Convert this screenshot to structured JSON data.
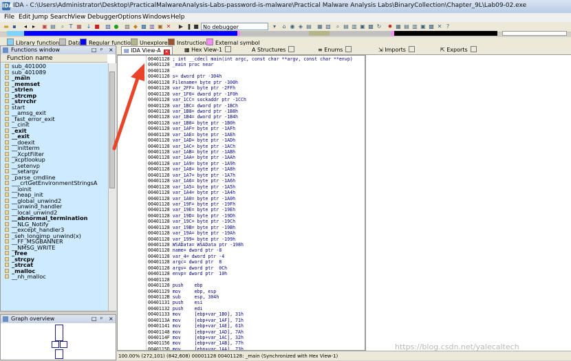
{
  "window": {
    "title": "IDA - C:\\Users\\Administrator\\Desktop\\PracticalMalwareAnalysis-Labs-password-is-malware\\Practical Malware Analysis Labs\\BinaryCollection\\Chapter_9L\\Lab09-02.exe",
    "app_icon_label": "IDA"
  },
  "menu": [
    "File",
    "Edit",
    "Jump",
    "Search",
    "View",
    "Debugger",
    "Options",
    "Windows",
    "Help"
  ],
  "toolbar": {
    "debugger_select": "No debugger"
  },
  "legend": [
    {
      "label": "Library function",
      "color": "#7fd4ff"
    },
    {
      "label": "Data",
      "color": "#c0c0c0"
    },
    {
      "label": "Regular function",
      "color": "#0000ff"
    },
    {
      "label": "Unexplored",
      "color": "#b5b58a"
    },
    {
      "label": "Instruction",
      "color": "#a0522d"
    },
    {
      "label": "External symbol",
      "color": "#ff88ff"
    }
  ],
  "functions_window": {
    "title": "Functions window",
    "column": "Function name",
    "items": [
      {
        "name": "sub_401000",
        "bold": false
      },
      {
        "name": "sub_401089",
        "bold": false
      },
      {
        "name": "_main",
        "bold": true
      },
      {
        "name": "_memset",
        "bold": true
      },
      {
        "name": "_strlen",
        "bold": true
      },
      {
        "name": "_strcmp",
        "bold": true
      },
      {
        "name": "_strrchr",
        "bold": true
      },
      {
        "name": "start",
        "bold": false
      },
      {
        "name": "__amsg_exit",
        "bold": false
      },
      {
        "name": "_fast_error_exit",
        "bold": false
      },
      {
        "name": "__cinit",
        "bold": false
      },
      {
        "name": "_exit",
        "bold": true
      },
      {
        "name": "__exit",
        "bold": true
      },
      {
        "name": "__doexit",
        "bold": false
      },
      {
        "name": "__initterm",
        "bold": false
      },
      {
        "name": "__XcptFilter",
        "bold": false
      },
      {
        "name": "_xcptlookup",
        "bold": false
      },
      {
        "name": "__setenvp",
        "bold": false
      },
      {
        "name": "__setargv",
        "bold": false
      },
      {
        "name": "_parse_cmdline",
        "bold": false
      },
      {
        "name": "___crtGetEnvironmentStringsA",
        "bold": false
      },
      {
        "name": "__ioinit",
        "bold": false
      },
      {
        "name": "__heap_init",
        "bold": false
      },
      {
        "name": "__global_unwind2",
        "bold": false
      },
      {
        "name": "__unwind_handler",
        "bold": false
      },
      {
        "name": "__local_unwind2",
        "bold": false
      },
      {
        "name": "__abnormal_termination",
        "bold": true
      },
      {
        "name": "__NLG_Notify",
        "bold": false
      },
      {
        "name": "__except_handler3",
        "bold": false
      },
      {
        "name": "_seh_longjmp_unwind(x)",
        "bold": false
      },
      {
        "name": "__FF_MSGBANNER",
        "bold": false
      },
      {
        "name": "__NMSG_WRITE",
        "bold": false
      },
      {
        "name": "_free",
        "bold": true
      },
      {
        "name": "_strcpy",
        "bold": true
      },
      {
        "name": "_strcat",
        "bold": true
      },
      {
        "name": "_malloc",
        "bold": true
      },
      {
        "name": "__nh_malloc",
        "bold": false
      }
    ]
  },
  "graph_overview": {
    "title": "Graph overview"
  },
  "tabs": [
    {
      "label": "IDA View-A",
      "active": true,
      "close": true
    },
    {
      "label": "Hex View-1",
      "active": false,
      "close": false
    },
    {
      "label": "Structures",
      "active": false,
      "close": false
    },
    {
      "label": "Enums",
      "active": false,
      "close": false
    },
    {
      "label": "Imports",
      "active": false,
      "close": false
    },
    {
      "label": "Exports",
      "active": false,
      "close": false
    }
  ],
  "disasm": [
    {
      "addr": "00401128",
      "text": "; int __cdecl main(int argc, const char **argv, const char **envp)"
    },
    {
      "addr": "00401128",
      "text": "_main proc near"
    },
    {
      "addr": "00401128",
      "text": ""
    },
    {
      "addr": "00401128",
      "text": "s= dword ptr -304h"
    },
    {
      "addr": "00401128",
      "text": "Filename= byte ptr -300h"
    },
    {
      "addr": "00401128",
      "text": "var_2FF= byte ptr -2FFh"
    },
    {
      "addr": "00401128",
      "text": "var_1F0= dword ptr -1F0h"
    },
    {
      "addr": "00401128",
      "text": "var_1CC= sockaddr ptr -1CCh"
    },
    {
      "addr": "00401128",
      "text": "var_1BC= dword ptr -1BCh"
    },
    {
      "addr": "00401128",
      "text": "var_1B8= dword ptr -1B8h"
    },
    {
      "addr": "00401128",
      "text": "var_1B4= dword ptr -1B4h"
    },
    {
      "addr": "00401128",
      "text": "var_1B0= byte ptr -1B0h"
    },
    {
      "addr": "00401128",
      "text": "var_1AF= byte ptr -1AFh"
    },
    {
      "addr": "00401128",
      "text": "var_1AE= byte ptr -1AEh"
    },
    {
      "addr": "00401128",
      "text": "var_1AD= byte ptr -1ADh"
    },
    {
      "addr": "00401128",
      "text": "var_1AC= byte ptr -1ACh"
    },
    {
      "addr": "00401128",
      "text": "var_1AB= byte ptr -1ABh"
    },
    {
      "addr": "00401128",
      "text": "var_1AA= byte ptr -1AAh"
    },
    {
      "addr": "00401128",
      "text": "var_1A9= byte ptr -1A9h"
    },
    {
      "addr": "00401128",
      "text": "var_1A8= byte ptr -1A8h"
    },
    {
      "addr": "00401128",
      "text": "var_1A7= byte ptr -1A7h"
    },
    {
      "addr": "00401128",
      "text": "var_1A6= byte ptr -1A6h"
    },
    {
      "addr": "00401128",
      "text": "var_1A5= byte ptr -1A5h"
    },
    {
      "addr": "00401128",
      "text": "var_1A4= byte ptr -1A4h"
    },
    {
      "addr": "00401128",
      "text": "var_1A0= byte ptr -1A0h"
    },
    {
      "addr": "00401128",
      "text": "var_19F= byte ptr -19Fh"
    },
    {
      "addr": "00401128",
      "text": "var_19E= byte ptr -19Eh"
    },
    {
      "addr": "00401128",
      "text": "var_19D= byte ptr -19Dh"
    },
    {
      "addr": "00401128",
      "text": "var_19C= byte ptr -19Ch"
    },
    {
      "addr": "00401128",
      "text": "var_19B= byte ptr -19Bh"
    },
    {
      "addr": "00401128",
      "text": "var_19A= byte ptr -19Ah"
    },
    {
      "addr": "00401128",
      "text": "var_199= byte ptr -199h"
    },
    {
      "addr": "00401128",
      "text": "WSAData= WSAData ptr -198h"
    },
    {
      "addr": "00401128",
      "text": "name= dword ptr -8"
    },
    {
      "addr": "00401128",
      "text": "var_4= dword ptr -4"
    },
    {
      "addr": "00401128",
      "text": "argc= dword ptr  8"
    },
    {
      "addr": "00401128",
      "text": "argv= dword ptr  0Ch"
    },
    {
      "addr": "00401128",
      "text": "envp= dword ptr  10h"
    },
    {
      "addr": "00401128",
      "text": ""
    },
    {
      "addr": "00401128",
      "text": "push    ebp"
    },
    {
      "addr": "00401129",
      "text": "mov     ebp, esp"
    },
    {
      "addr": "0040112B",
      "text": "sub     esp, 304h"
    },
    {
      "addr": "00401131",
      "text": "push    esi"
    },
    {
      "addr": "00401132",
      "text": "push    edi"
    },
    {
      "addr": "00401133",
      "text": "mov     [ebp+var_1B0], 31h"
    },
    {
      "addr": "0040113A",
      "text": "mov     [ebp+var_1AF], 71h"
    },
    {
      "addr": "00401141",
      "text": "mov     [ebp+var_1AE], 61h"
    },
    {
      "addr": "00401148",
      "text": "mov     [ebp+var_1AD], 7Ah"
    },
    {
      "addr": "0040114F",
      "text": "mov     [ebp+var_1AC], 32h"
    },
    {
      "addr": "00401156",
      "text": "mov     [ebp+var_1AB], 77h"
    },
    {
      "addr": "0040115D",
      "text": "mov     [ebp+var_1AA], 73h"
    }
  ],
  "status": "100.00% (272,101) (842,608) 00001128 00401128: _main (Synchronized with Hex View-1)",
  "watermark": "https://blog.csdn.net/yalecaltech"
}
